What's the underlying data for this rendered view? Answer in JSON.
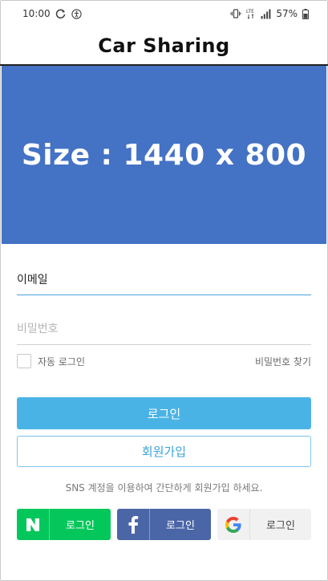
{
  "status_bar": {
    "time": "10:00",
    "battery": "57%",
    "icons": [
      "sync-icon",
      "accessibility-icon",
      "vibrate-icon",
      "lte-icon",
      "signal-icon",
      "battery-icon"
    ]
  },
  "header": {
    "title": "Car Sharing"
  },
  "banner": {
    "text": "Size : 1440 x 800",
    "color": "#4472c4"
  },
  "form": {
    "email_value": "이메일",
    "password_placeholder": "비밀번호",
    "auto_login_label": "자동 로그인",
    "find_password_label": "비밀번호 찾기"
  },
  "buttons": {
    "login": "로그인",
    "signup": "회원가입"
  },
  "sns": {
    "note": "SNS  계정을 이용하여 간단하게 회원가입 하세요.",
    "naver_label": "로그인",
    "facebook_label": "로그인",
    "google_label": "로그인",
    "naver_color": "#03c75a",
    "facebook_color": "#4b66a7"
  },
  "accent_color": "#4ab3e5"
}
